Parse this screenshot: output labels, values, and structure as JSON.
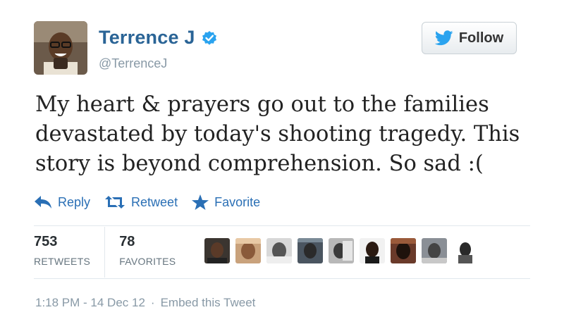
{
  "user": {
    "name": "Terrence J",
    "handle": "@TerrenceJ",
    "verified": true
  },
  "follow_button": {
    "label": "Follow",
    "icon": "bird-icon"
  },
  "tweet": {
    "lines": [
      "My heart & prayers go out to the families",
      "devastated by today's shooting tragedy. This",
      "story is beyond comprehension. So sad :("
    ]
  },
  "actions": [
    {
      "label": "Reply",
      "icon": "reply-icon"
    },
    {
      "label": "Retweet",
      "icon": "retweet-icon"
    },
    {
      "label": "Favorite",
      "icon": "star-icon"
    }
  ],
  "stats": {
    "retweets": {
      "count": "753",
      "label": "RETWEETS"
    },
    "favorites": {
      "count": "78",
      "label": "FAVORITES"
    }
  },
  "meta": {
    "timestamp": "1:18 PM - 14 Dec 12",
    "separator": "·",
    "embed": "Embed this Tweet"
  },
  "colors": {
    "link": "#2a6496",
    "action": "#2a6fb5",
    "muted": "#8899a6",
    "verified": "#2aa3ef"
  }
}
